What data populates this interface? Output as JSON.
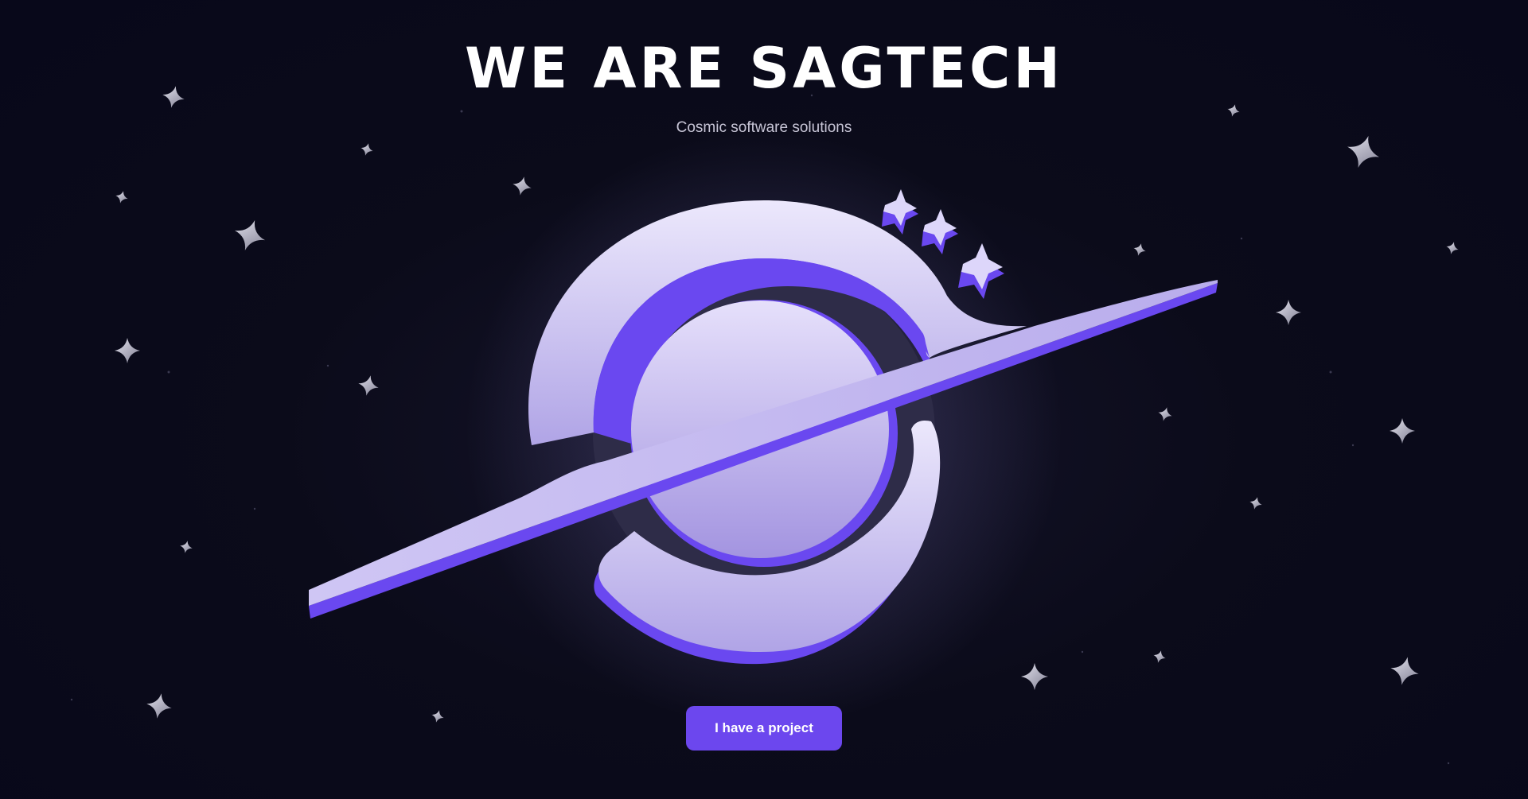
{
  "hero": {
    "headline": "WE ARE SAGTECH",
    "tagline": "Cosmic software solutions",
    "cta_label": "I have a project"
  },
  "logo": {
    "name": "planet-logo",
    "icon": "saturn-planet-icon"
  },
  "colors": {
    "background": "#0a0a18",
    "accent": "#6c47ee",
    "planet_light": "#e6e0fb",
    "planet_mid": "#b9adec",
    "planet_shadow": "#6a48f0",
    "star": "#b8b7c8",
    "headline": "#ffffff",
    "tagline": "#c7c5d6"
  }
}
